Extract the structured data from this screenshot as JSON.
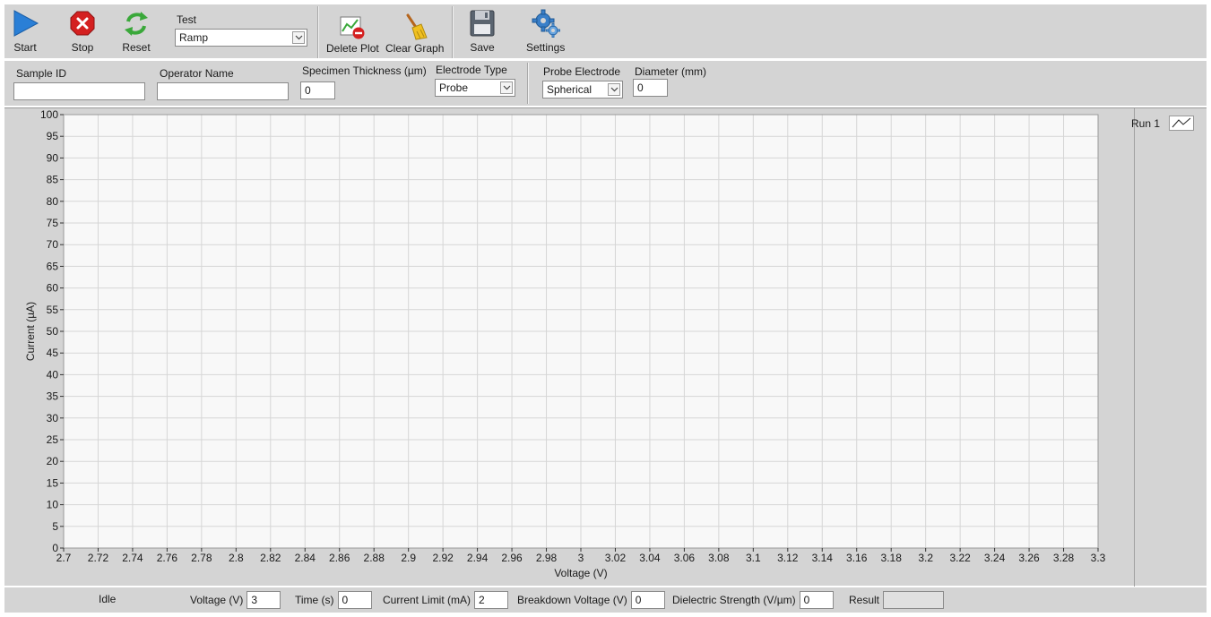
{
  "toolbar": {
    "start": "Start",
    "stop": "Stop",
    "reset": "Reset",
    "test_label": "Test",
    "test_value": "Ramp",
    "delete_plot": "Delete Plot",
    "clear_graph": "Clear Graph",
    "save": "Save",
    "settings": "Settings"
  },
  "params": {
    "sample_id_label": "Sample ID",
    "sample_id_value": "",
    "operator_label": "Operator Name",
    "operator_value": "",
    "thickness_label": "Specimen Thickness (µm)",
    "thickness_value": "0",
    "electrode_type_label": "Electrode Type",
    "electrode_type_value": "Probe",
    "probe_electrode_label": "Probe Electrode",
    "probe_electrode_value": "Spherical",
    "diameter_label": "Diameter (mm)",
    "diameter_value": "0"
  },
  "colors": {
    "panel": "#d4d4d4",
    "plot_bg": "#f8f8f8",
    "grid": "#d6d6d6",
    "start_blue": "#2a7fd6",
    "stop_red": "#d42020",
    "reset_green": "#3aa83a"
  },
  "chart_data": {
    "type": "line",
    "xlabel": "Voltage (V)",
    "ylabel": "Current (µA)",
    "xlim": [
      2.7,
      3.3
    ],
    "ylim": [
      0,
      100
    ],
    "x_ticks": [
      "2.7",
      "2.72",
      "2.74",
      "2.76",
      "2.78",
      "2.8",
      "2.82",
      "2.84",
      "2.86",
      "2.88",
      "2.9",
      "2.92",
      "2.94",
      "2.96",
      "2.98",
      "3",
      "3.02",
      "3.04",
      "3.06",
      "3.08",
      "3.1",
      "3.12",
      "3.14",
      "3.16",
      "3.18",
      "3.2",
      "3.22",
      "3.24",
      "3.26",
      "3.28",
      "3.3"
    ],
    "y_ticks": [
      "0",
      "5",
      "10",
      "15",
      "20",
      "25",
      "30",
      "35",
      "40",
      "45",
      "50",
      "55",
      "60",
      "65",
      "70",
      "75",
      "80",
      "85",
      "90",
      "95",
      "100"
    ],
    "grid": true,
    "legend_position": "top-right",
    "series": [
      {
        "name": "Run 1",
        "x": [],
        "y": []
      }
    ]
  },
  "status": {
    "state": "Idle",
    "voltage_label": "Voltage (V)",
    "voltage_value": "3",
    "time_label": "Time (s)",
    "time_value": "0",
    "current_limit_label": "Current Limit (mA)",
    "current_limit_value": "2",
    "breakdown_label": "Breakdown Voltage (V)",
    "breakdown_value": "0",
    "dielectric_label": "Dielectric Strength (V/µm)",
    "dielectric_value": "0",
    "result_label": "Result",
    "result_value": ""
  }
}
